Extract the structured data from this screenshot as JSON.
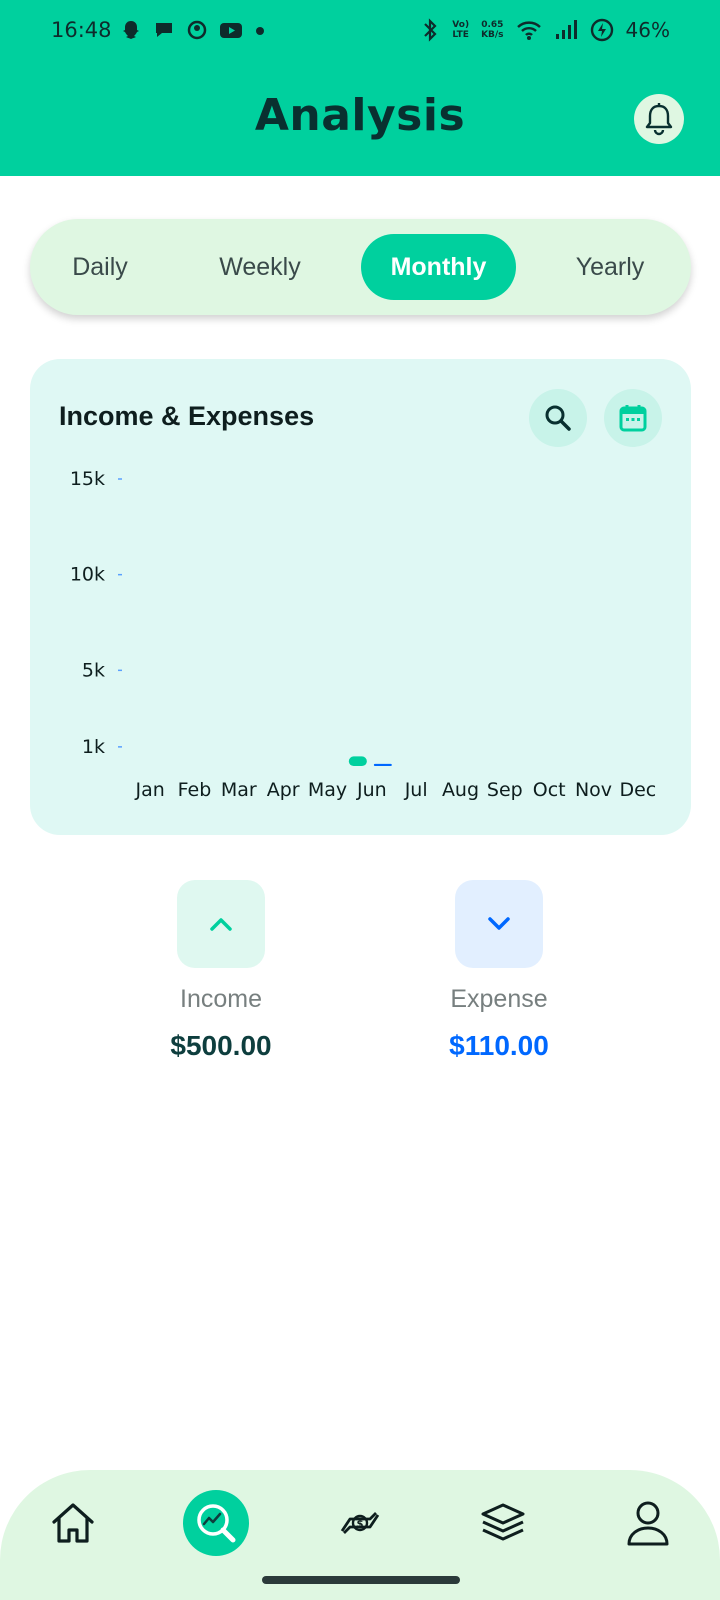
{
  "status_bar": {
    "time": "16:48",
    "network_speed_value": "0.65",
    "network_speed_unit": "KB/s",
    "volte_top": "Vo)",
    "volte_bottom": "LTE",
    "battery": "46%",
    "left_icons": [
      "snapchat-icon",
      "chat-icon",
      "app-icon",
      "youtube-icon",
      "dot-icon"
    ],
    "right_icons": [
      "bluetooth-icon",
      "volte-icon",
      "wifi-icon",
      "signal-icon",
      "battery-icon"
    ]
  },
  "header": {
    "title": "Analysis",
    "notification_icon": "bell-icon"
  },
  "tabs": [
    {
      "label": "Daily",
      "active": false
    },
    {
      "label": "Weekly",
      "active": false
    },
    {
      "label": "Monthly",
      "active": true
    },
    {
      "label": "Yearly",
      "active": false
    }
  ],
  "card": {
    "title": "Income & Expenses",
    "search_icon": "search-icon",
    "calendar_icon": "calendar-icon"
  },
  "chart_data": {
    "type": "bar",
    "title": "Income & Expenses",
    "categories": [
      "Jan",
      "Feb",
      "Mar",
      "Apr",
      "May",
      "Jun",
      "Jul",
      "Aug",
      "Sep",
      "Oct",
      "Nov",
      "Dec"
    ],
    "y_ticks": [
      {
        "value": 15000,
        "label": "15k"
      },
      {
        "value": 10000,
        "label": "10k"
      },
      {
        "value": 5000,
        "label": "5k"
      },
      {
        "value": 1000,
        "label": "1k"
      }
    ],
    "series": [
      {
        "values": [
          0,
          0,
          0,
          0,
          0,
          500,
          0,
          0,
          0,
          0,
          0,
          0
        ],
        "color": "#00d09e"
      },
      {
        "values": [
          0,
          0,
          0,
          0,
          0,
          110,
          0,
          0,
          0,
          0,
          0,
          0
        ],
        "color": "#0068ff"
      }
    ],
    "ylim": [
      0,
      15000
    ],
    "grid": false
  },
  "summary": {
    "income": {
      "label": "Income",
      "value": "$500.00",
      "icon": "chevron-up-icon",
      "color": "#0e3e3e"
    },
    "expense": {
      "label": "Expense",
      "value": "$110.00",
      "icon": "chevron-down-icon",
      "color": "#0068ff"
    }
  },
  "nav": [
    {
      "icon": "home-icon",
      "active": false
    },
    {
      "icon": "analysis-icon",
      "active": true
    },
    {
      "icon": "transactions-icon",
      "active": false
    },
    {
      "icon": "categories-icon",
      "active": false
    },
    {
      "icon": "profile-icon",
      "active": false
    }
  ],
  "colors": {
    "primary": "#00d09e",
    "light": "#dff7e2",
    "card": "#dff8f4",
    "expense": "#0068ff"
  }
}
